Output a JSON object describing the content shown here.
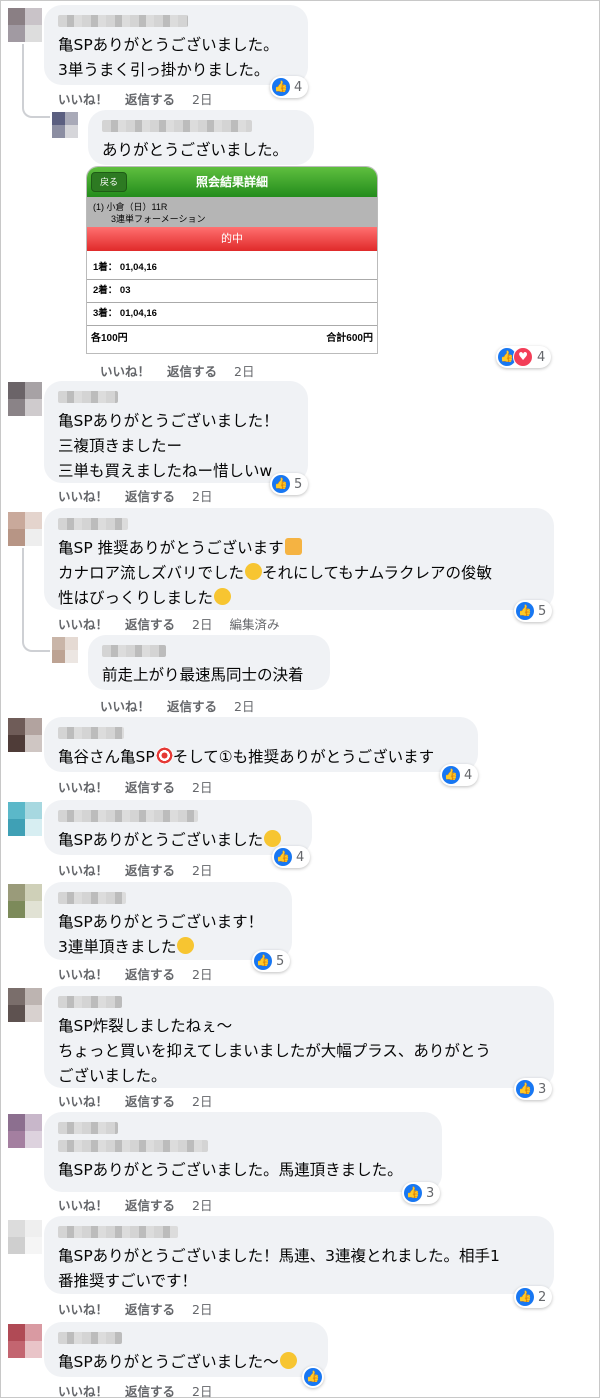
{
  "actions": {
    "like": "いいね！",
    "reply": "返信する",
    "time": "2日",
    "edited": "編集済み"
  },
  "comments": [
    {
      "text": "亀SPありがとうございました。\n3単うまく引っ掛かりました。",
      "count": "4"
    },
    {
      "text": "ありがとうございました。",
      "count": "4"
    },
    {
      "text": "亀SPありがとうございました！\n三複頂きましたー\n三単も買えましたねー惜しいw",
      "count": "5"
    },
    {
      "text": "亀SP 推奨ありがとうございます",
      "text2": "カナロア流しズバリでした",
      "text3": "それにしてもナムラクレアの俊敏",
      "text4": "性はびっくりしました",
      "count": "5"
    },
    {
      "text": "前走上がり最速馬同士の決着"
    },
    {
      "text": "亀谷さん亀SP",
      "text2": "そして①も推奨ありがとうございます",
      "count": "4"
    },
    {
      "text": "亀SPありがとうございました",
      "count": "4"
    },
    {
      "text": "亀SPありがとうございます！\n3連単頂きました",
      "count": "5"
    },
    {
      "text": "亀SP炸裂しましたねぇ〜\nちょっと買いを抑えてしまいましたが大幅プラス、ありがとう\nございました。",
      "count": "3"
    },
    {
      "text": "亀SPありがとうございました。馬連頂きました。",
      "count": "3"
    },
    {
      "text": "亀SPありがとうございました！馬連、3連複とれました。相手1\n番推奨すごいです！",
      "count": "2"
    },
    {
      "text": "亀SPありがとうございました〜"
    }
  ],
  "ticket": {
    "back": "戻る",
    "title": "照会結果詳細",
    "race": "(1) 小倉（日）11R",
    "bet_type": "3連単フォーメーション",
    "result": "的中",
    "row1": "1着： 01,04,16",
    "row2": "2着： 03",
    "row3": "3着： 01,04,16",
    "unit": "各100円",
    "total": "合計600円"
  },
  "icons": {
    "like": "like-thumb-icon",
    "heart": "love-heart-icon"
  },
  "colors": {
    "like_blue": "#1877f2",
    "bubble": "#f0f2f5",
    "meta": "#65676b",
    "ticket_green": "#238c1c",
    "ticket_red": "#e02a2a"
  }
}
